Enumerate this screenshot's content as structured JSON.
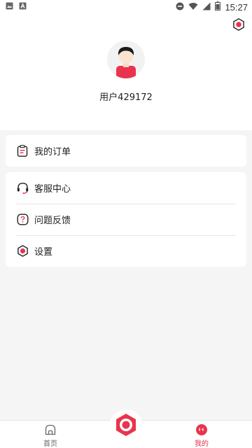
{
  "status_bar": {
    "time": "15:27",
    "icons": [
      "image-icon",
      "a-icon",
      "dnd-icon",
      "wifi-icon",
      "signal-icon",
      "battery-icon"
    ]
  },
  "profile": {
    "username": "用户429172"
  },
  "menu_primary": [
    {
      "label": "我的订单",
      "icon": "clipboard-icon"
    }
  ],
  "menu_secondary": [
    {
      "label": "客服中心",
      "icon": "headset-icon"
    },
    {
      "label": "问题反馈",
      "icon": "question-icon"
    },
    {
      "label": "设置",
      "icon": "gear-icon"
    }
  ],
  "bottom_nav": {
    "home_label": "首页",
    "mine_label": "我的",
    "active": "我的"
  },
  "colors": {
    "accent": "#e8344e",
    "background": "#f5f5f5",
    "card": "#ffffff"
  }
}
